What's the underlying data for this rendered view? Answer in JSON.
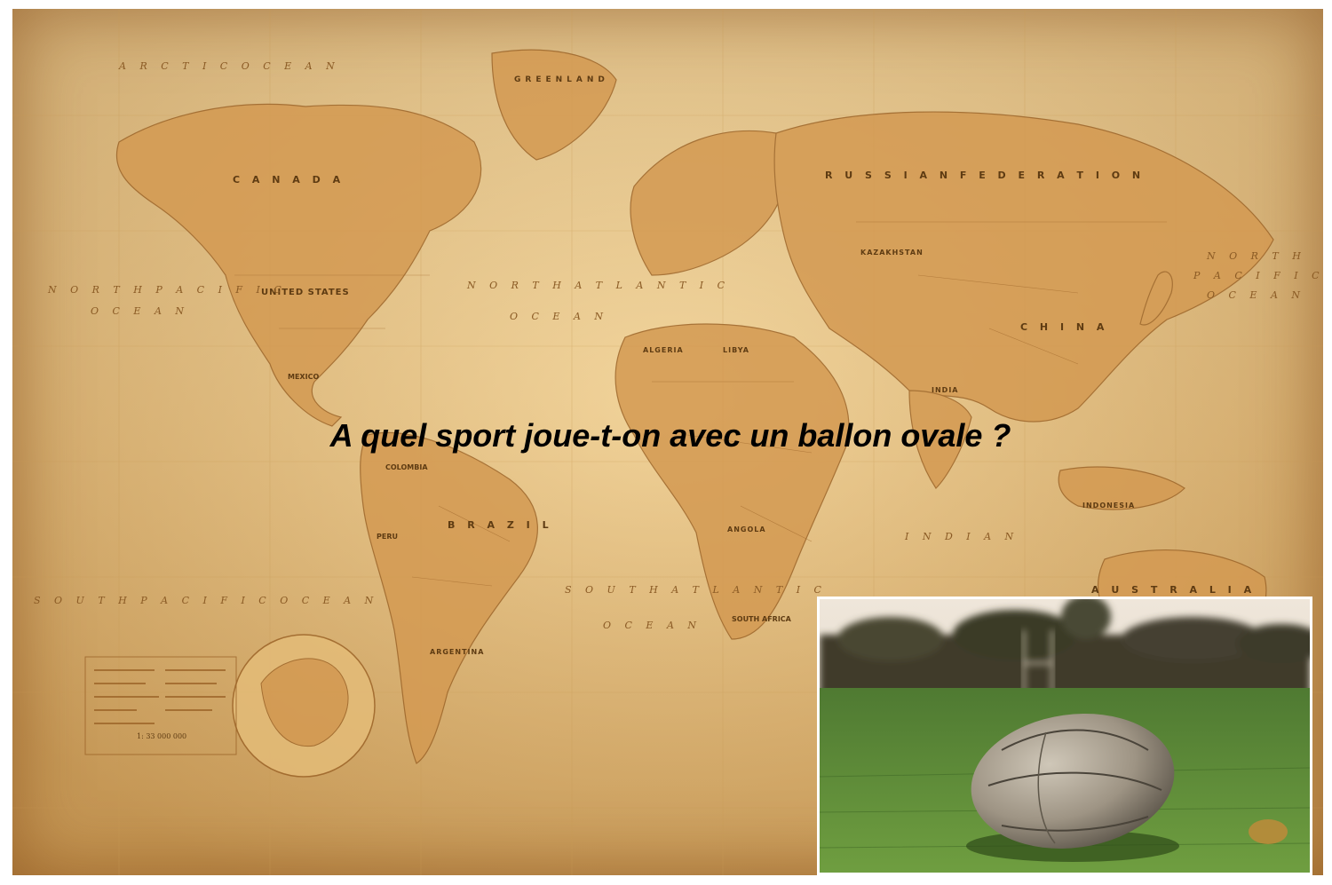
{
  "question": "A quel sport joue-t-on avec un ballon ovale ?",
  "map": {
    "labels": {
      "canada": "C A N A D A",
      "russia": "R U S S I A N   F E D E R A T I O N",
      "united_states": "UNITED STATES",
      "brazil": "B R A Z I L",
      "china": "C H I N A",
      "india": "INDIA",
      "australia": "A U S T R A L I A",
      "greenland": "GREENLAND",
      "north_pacific_left": "N O R T H   P A C I F I C",
      "ocean_left": "O C E A N",
      "north_pacific_right": "N O R T H",
      "pacific_right": "P A C I F I C",
      "ocean_right": "O C E A N",
      "north_atlantic": "N O R T H   A T L A N T I C",
      "ocean_na": "O C E A N",
      "south_atlantic": "S O U T H   A T L A N T I C",
      "ocean_sa": "O C E A N",
      "south_pacific": "S O U T H   P A C I F I C   O C E A N",
      "indian": "I N D I A N",
      "arctic_ocean": "A R C T I C   O C E A N",
      "argentina": "ARGENTINA",
      "kazakhstan": "KAZAKHSTAN",
      "algeria": "ALGERIA",
      "angola": "ANGOLA",
      "indonesia": "INDONESIA",
      "mexico": "MEXICO",
      "peru": "PERU",
      "colombia": "COLOMBIA",
      "libya": "LIBYA",
      "south_africa": "SOUTH AFRICA",
      "scale": "1: 33 000 000"
    }
  },
  "photo": {
    "alt": "Ballon de rugby sur un terrain"
  }
}
